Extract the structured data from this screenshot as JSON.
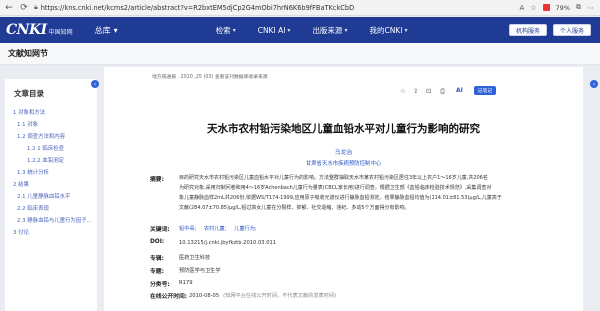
{
  "browser": {
    "url": "https://kns.cnki.net/kcms2/article/abstract?v=R2bxtEM5djCp2G4mObi7hrN6K6b9fFBaTKckCbDwmbUhi66i2l",
    "zoom": "79%"
  },
  "header": {
    "logo_text": "CNKI",
    "logo_sub": "中国知网",
    "home_label": "总库",
    "nav": [
      "检索",
      "CNKI AI",
      "出版来源",
      "我的CNKI"
    ],
    "btn_org": "机构服务",
    "btn_personal": "个人服务"
  },
  "subbar": {
    "title": "文献知网节"
  },
  "toc": {
    "heading": "文章目录",
    "items": [
      {
        "label": "1 对象和方法",
        "level": 1
      },
      {
        "label": "1.1 对象",
        "level": 2
      },
      {
        "label": "1.2 调查方法和内容",
        "level": 2
      },
      {
        "label": "1.2.1 临床检查",
        "level": 3
      },
      {
        "label": "1.2.2 血铅测定",
        "level": 3
      },
      {
        "label": "1.3 统计分析",
        "level": 2
      },
      {
        "label": "2 结果",
        "level": 1
      },
      {
        "label": "2.1 儿童静脉血铅水平",
        "level": 2
      },
      {
        "label": "2.2 临床表现",
        "level": 2
      },
      {
        "label": "2.3 静脉血铅与儿童行为因子...",
        "level": 2
      },
      {
        "label": "3 讨论",
        "level": 1
      }
    ]
  },
  "article": {
    "source_line": "地方病通报 . 2010 ,25 (03)  查看该刊数据库收录来源",
    "tools": [
      "☆",
      "⇪",
      "⊡",
      "⎙"
    ],
    "ai_label": "AI",
    "note_label": "记笔记",
    "title": "天水市农村铅污染地区儿童血铅水平对儿童行为影响的研究",
    "author": "马龙治",
    "org": "甘肃省天水市疾病预防控制中心",
    "labels": {
      "abstract": "摘要:",
      "keywords": "关键词:",
      "doi": "DOI:",
      "topic": "专辑:",
      "subject": "专题:",
      "classno": "分类号:",
      "pubdate": "在线公开时间:"
    },
    "abstract_lines": [
      "目的研究天水市农村铅污染区儿童血铅水平对儿童行为的影响。方法整群抽取天水市某农村铅污染区居住3年以上农户1～16岁儿童,共206名",
      "为研究对象,采用归制问卷和用4～16岁Achenbach儿童行为量表(CBCL家长用)进行调查。根据卫生部《血铅临床检验技术规范》,采集调查对",
      "象儿童静脉血样2mL共206份,依据WS/T174-1999,应用原子吸收光谱仪进行静脉血铅测定。结果静脉血铅均值为(114.01±81.53)μg/L,儿童高于",
      "文献(284.07±70.85)μg/L,铅过高女儿童在分裂样、抑郁、社交退缩、违纪、多动5个方面得分有影响。"
    ],
    "keywords": [
      "铅中毒;",
      "农村儿童;",
      "儿童行为;"
    ],
    "doi": "10.13215/j.cnki.jbyfkztb.2010.03.011",
    "topic": "医药卫生科技",
    "subject": "预防医学与卫生学",
    "classno": "R179",
    "pubdate": "2010-08-05",
    "pubdate_note": "(知网平台在线公开时间，不代表文献的发表时间)"
  }
}
